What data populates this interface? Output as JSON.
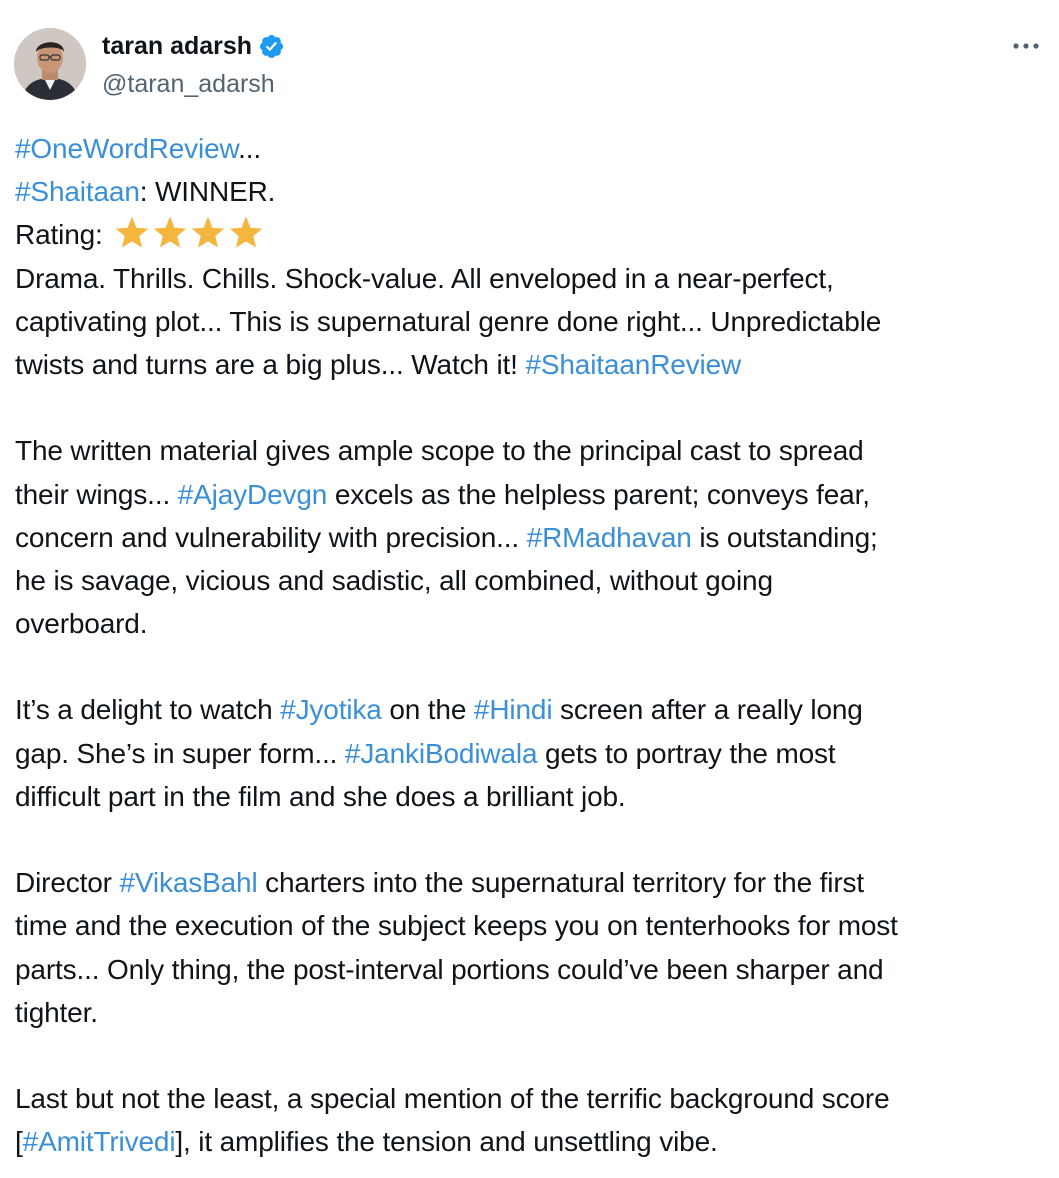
{
  "author": {
    "display_name": "taran adarsh",
    "handle": "@taran_adarsh",
    "verified": true,
    "verified_badge_color": "#1d9bf0"
  },
  "menu": {
    "icon": "more-horizontal-icon"
  },
  "tweet": {
    "line1": {
      "tag": "#OneWordReview",
      "text": "..."
    },
    "line2": {
      "tag": "#Shaitaan",
      "text": ": WINNER."
    },
    "rating": {
      "label": "Rating:",
      "stars": 4,
      "star_color": "#f4b63f"
    },
    "para1": {
      "l1": "Drama. Thrills. Chills. Shock-value. All enveloped in a near-perfect,",
      "l2": "captivating plot... This is supernatural genre done right... Unpredictable",
      "l3_text": "twists and turns are a big plus... Watch it! ",
      "l3_tag": "#ShaitaanReview"
    },
    "para2": {
      "l1": "The written material gives ample scope to the principal cast to spread",
      "l2_a": "their wings... ",
      "l2_tag": "#AjayDevgn",
      "l2_b": " excels as the helpless parent; conveys fear,",
      "l3_a": "concern and vulnerability with precision... ",
      "l3_tag": "#RMadhavan",
      "l3_b": " is outstanding;",
      "l4": "he is savage, vicious and sadistic, all combined, without going",
      "l5": "overboard."
    },
    "para3": {
      "l1_a": "It’s a delight to watch ",
      "l1_tag1": "#Jyotika",
      "l1_b": " on the ",
      "l1_tag2": "#Hindi",
      "l1_c": " screen after a really long",
      "l2_a": "gap. She’s in super form... ",
      "l2_tag": "#JankiBodiwala",
      "l2_b": " gets to portray the most",
      "l3": "difficult part in the film and she does a brilliant job."
    },
    "para4": {
      "l1_a": "Director ",
      "l1_tag": "#VikasBahl",
      "l1_b": " charters into the supernatural territory for the first",
      "l2": "time and the execution of the subject keeps you on tenterhooks for most",
      "l3": "parts... Only thing, the post-interval portions could’ve been sharper and",
      "l4": "tighter."
    },
    "para5": {
      "l1": "Last but not the least, a special mention of the terrific background score",
      "l2_a": "[",
      "l2_tag": "#AmitTrivedi",
      "l2_b": "], it amplifies the tension and unsettling vibe."
    }
  },
  "colors": {
    "text": "#0f1419",
    "secondary": "#536471",
    "link": "#3b8fd6"
  }
}
